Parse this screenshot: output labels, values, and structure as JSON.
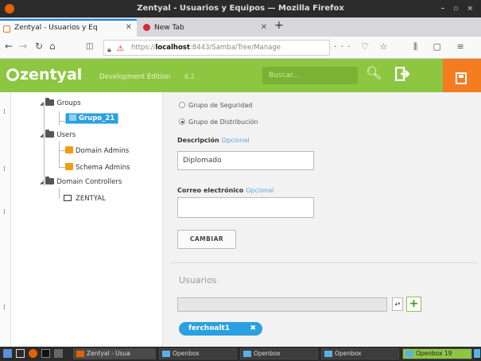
{
  "window": {
    "title": "Zentyal - Usuarios y Equipos — Mozilla Firefox"
  },
  "tabs": [
    {
      "label": "Zentyal - Usuarios y Eq",
      "active": true
    },
    {
      "label": "New Tab",
      "active": false
    }
  ],
  "navbar": {
    "url_prefix": "https://",
    "url_host": "localhost",
    "url_rest": ":8443/Samba/Tree/Manage"
  },
  "header": {
    "logo": "zentyal",
    "edition": "Development Edition",
    "version": "6.2",
    "search_placeholder": "Buscar..."
  },
  "tree": {
    "groups_label": "Groups",
    "selected_group": "Grupo_21",
    "users_label": "Users",
    "users_items": [
      "Domain Admins",
      "Schema Admins"
    ],
    "controllers_label": "Domain Controllers",
    "controllers_items": [
      "ZENTYAL"
    ]
  },
  "form": {
    "radio_security": "Grupo de Seguridad",
    "radio_distribution": "Grupo de Distribución",
    "description_label": "Descripción",
    "optional": "Opcional",
    "description_value": "Diplomado",
    "email_label": "Correo electrónico",
    "email_value": "",
    "change_button": "CAMBIAR",
    "users_label": "Usuarios",
    "members": [
      "ferchoalt1"
    ]
  },
  "taskbar": {
    "items": [
      "Zentyal - Usua",
      "Openbox",
      "Openbox",
      "Openbox",
      "Openbox 19"
    ]
  },
  "colors": {
    "zentyal_green": "#8dc641",
    "save_orange": "#f47c20",
    "selection_blue": "#2aa0e0"
  }
}
